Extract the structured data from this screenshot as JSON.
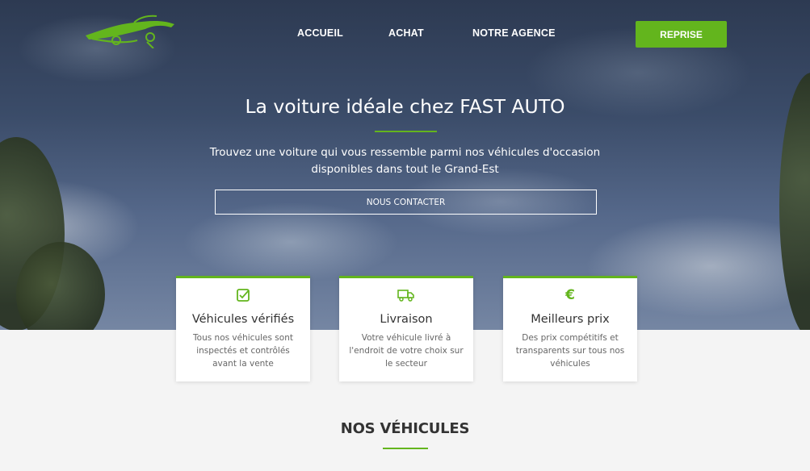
{
  "nav": {
    "items": [
      {
        "label": "ACCUEIL"
      },
      {
        "label": "ACHAT"
      },
      {
        "label": "NOTRE AGENCE"
      }
    ],
    "cta_label": "REPRISE"
  },
  "hero": {
    "title": "La voiture idéale chez FAST AUTO",
    "subtitle_line1": "Trouvez une voiture qui vous ressemble parmi nos véhicules d'occasion",
    "subtitle_line2": "disponibles dans tout le Grand-Est",
    "button_label": "NOUS CONTACTER"
  },
  "features": [
    {
      "icon": "check-square-icon",
      "title": "Véhicules vérifiés",
      "lines": [
        "Tous nos véhicules sont",
        "inspectés et contrôlés",
        "avant la vente"
      ]
    },
    {
      "icon": "truck-icon",
      "title": "Livraison",
      "lines": [
        "Votre véhicule livré à",
        "l'endroit de votre choix sur",
        "le secteur"
      ]
    },
    {
      "icon": "euro-icon",
      "title": "Meilleurs prix",
      "lines": [
        "Des prix compétitifs et",
        "transparents sur tous nos",
        "véhicules"
      ]
    }
  ],
  "section": {
    "title": "NOS VÉHICULES"
  },
  "colors": {
    "accent": "#63b51d",
    "text_dark": "#333333",
    "text_muted": "#666666",
    "background": "#f4f4f4"
  }
}
